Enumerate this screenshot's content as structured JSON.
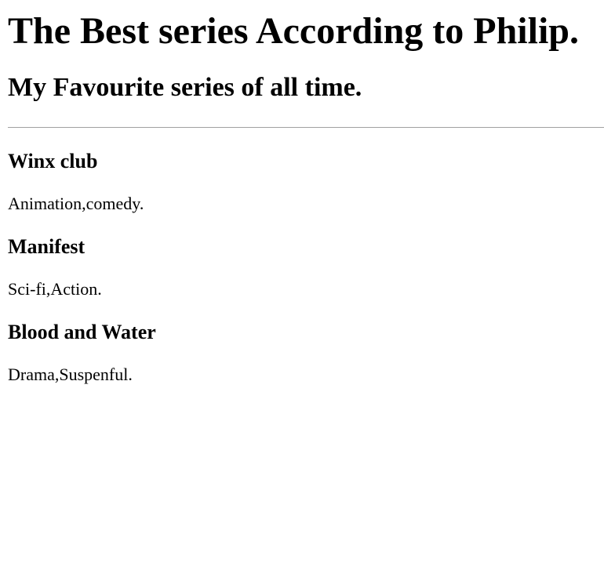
{
  "page": {
    "title": "The Best series According to Philip.",
    "subtitle": "My Favourite series of all time."
  },
  "series": [
    {
      "name": "Winx club",
      "genre": "Animation,comedy."
    },
    {
      "name": "Manifest",
      "genre": "Sci-fi,Action."
    },
    {
      "name": "Blood and Water",
      "genre": "Drama,Suspenful."
    }
  ]
}
